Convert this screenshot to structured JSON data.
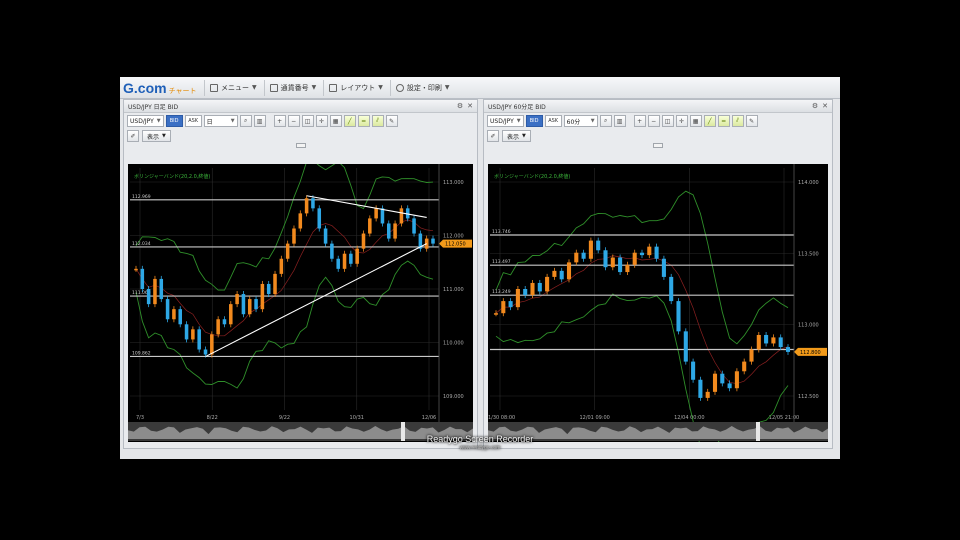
{
  "app": {
    "logo": "G.com",
    "logo_sub": "チャート",
    "menu": [
      {
        "label": "メニュー",
        "icon": "menu-icon"
      },
      {
        "label": "通貨番号",
        "icon": "list-icon"
      },
      {
        "label": "レイアウト",
        "icon": "layout-icon"
      },
      {
        "label": "設定・印刷",
        "icon": "gear-icon"
      }
    ]
  },
  "panels": [
    {
      "title": "USD/JPY 日足 BID",
      "symbol": "USD/JPY",
      "bid": "BID",
      "ask": "ASK",
      "timeframe": "日",
      "display_label": "表示",
      "indicator": "ボリンジャーバンド(20,2.0,終値)",
      "price_ticks": [
        "113.000",
        "112.000",
        "111.000",
        "110.000",
        "109.000"
      ],
      "level_labels": [
        "112.969",
        "112.034",
        "111.060",
        "109.862"
      ],
      "current_price": "112.050",
      "date_ticks": [
        "7/3",
        "8/22",
        "9/22",
        "10/31",
        "12/06"
      ],
      "chart_data": {
        "type": "line",
        "title": "",
        "closes": [
          111.6,
          111.2,
          110.9,
          111.4,
          111.0,
          110.6,
          110.8,
          110.5,
          110.2,
          110.4,
          110.0,
          109.9,
          110.3,
          110.6,
          110.5,
          110.9,
          111.1,
          110.7,
          111.0,
          110.8,
          111.3,
          111.1,
          111.5,
          111.8,
          112.1,
          112.4,
          112.7,
          113.0,
          112.8,
          112.4,
          112.1,
          111.8,
          111.6,
          111.9,
          111.7,
          112.0,
          112.3,
          112.6,
          112.8,
          112.5,
          112.2,
          112.5,
          112.8,
          112.6,
          112.3,
          112.0,
          112.2,
          112.1
        ],
        "horizontal_levels": [
          112.969,
          112.034,
          111.06,
          109.862
        ],
        "ylim": [
          108.8,
          113.6
        ],
        "grid": true
      }
    },
    {
      "title": "USD/JPY 60分足 BID",
      "symbol": "USD/JPY",
      "bid": "BID",
      "ask": "ASK",
      "timeframe": "60分",
      "display_label": "表示",
      "indicator": "ボリンジャーバンド(20,2.0,終値)",
      "price_ticks": [
        "114.000",
        "113.500",
        "113.000",
        "112.500"
      ],
      "level_labels": [
        "113.746",
        "113.497",
        "113.249"
      ],
      "current_price": "112.800",
      "date_ticks": [
        "11/30 08:00",
        "12/01 09:00",
        "12/04 00:00",
        "12/05 21:00"
      ],
      "chart_data": {
        "type": "line",
        "title": "",
        "closes": [
          113.1,
          113.2,
          113.15,
          113.3,
          113.25,
          113.35,
          113.28,
          113.4,
          113.45,
          113.38,
          113.52,
          113.6,
          113.55,
          113.7,
          113.62,
          113.48,
          113.56,
          113.44,
          113.5,
          113.6,
          113.58,
          113.65,
          113.55,
          113.4,
          113.2,
          112.95,
          112.7,
          112.55,
          112.4,
          112.45,
          112.6,
          112.52,
          112.48,
          112.62,
          112.7,
          112.8,
          112.92,
          112.85,
          112.9,
          112.82,
          112.78
        ],
        "horizontal_levels": [
          113.746,
          113.497,
          113.249,
          112.8
        ],
        "ylim": [
          112.3,
          114.3
        ],
        "grid": true
      }
    }
  ],
  "watermark": {
    "text": "Readygo Screen Recorder",
    "url": "www.readygo.com"
  },
  "colors": {
    "up": "#f28a1e",
    "down": "#2ea8e6",
    "band": "#2f8f2a",
    "level": "#c8c8c8",
    "trend": "#ffffff",
    "price_tag": "#f29a1a",
    "grid": "#2a2a2a"
  }
}
